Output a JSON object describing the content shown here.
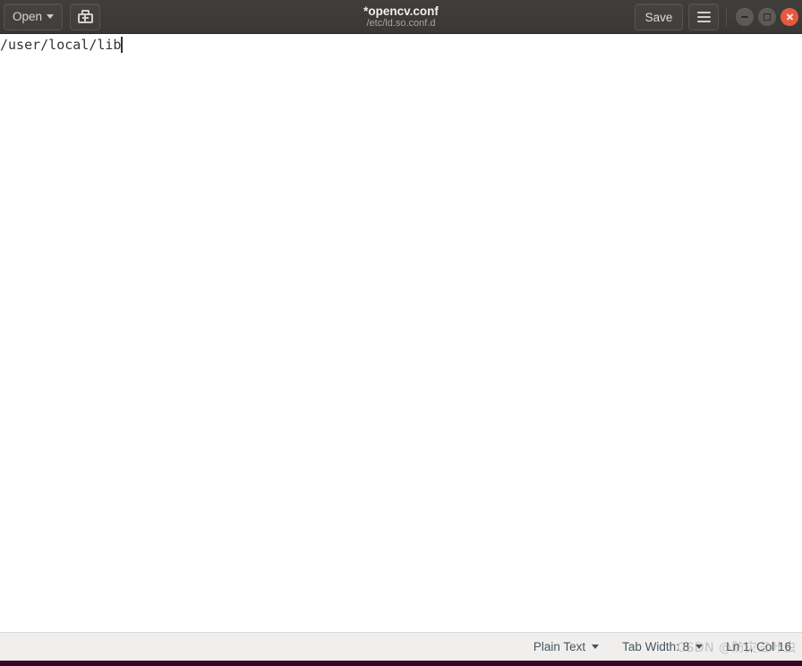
{
  "window": {
    "title": "*opencv.conf",
    "subtitle": "/etc/ld.so.conf.d"
  },
  "header": {
    "open_label": "Open",
    "new_document_icon": "new-document-icon",
    "save_label": "Save",
    "menu_icon": "hamburger-menu-icon",
    "window_controls": {
      "minimize": "minimize-icon",
      "maximize": "maximize-icon",
      "close": "close-icon"
    },
    "colors": {
      "bar_background": "#3f3d3a",
      "button_background": "#454340",
      "close_button": "#e8573f",
      "title_text": "#f2efea",
      "subtitle_text": "#a8a49e"
    }
  },
  "editor": {
    "lines": [
      "/user/local/lib"
    ],
    "caret_visible": true,
    "background": "#ffffff",
    "text_color": "#2e3436"
  },
  "statusbar": {
    "language_label": "Plain Text",
    "tab_width_label": "Tab Width: 8",
    "position_label": "Ln 1, Col 16",
    "watermark": "CSDN @防灾三叶虫",
    "background": "#f0efee",
    "text_color": "#46565e"
  },
  "bottom_bar": {
    "color": "#35062a"
  }
}
